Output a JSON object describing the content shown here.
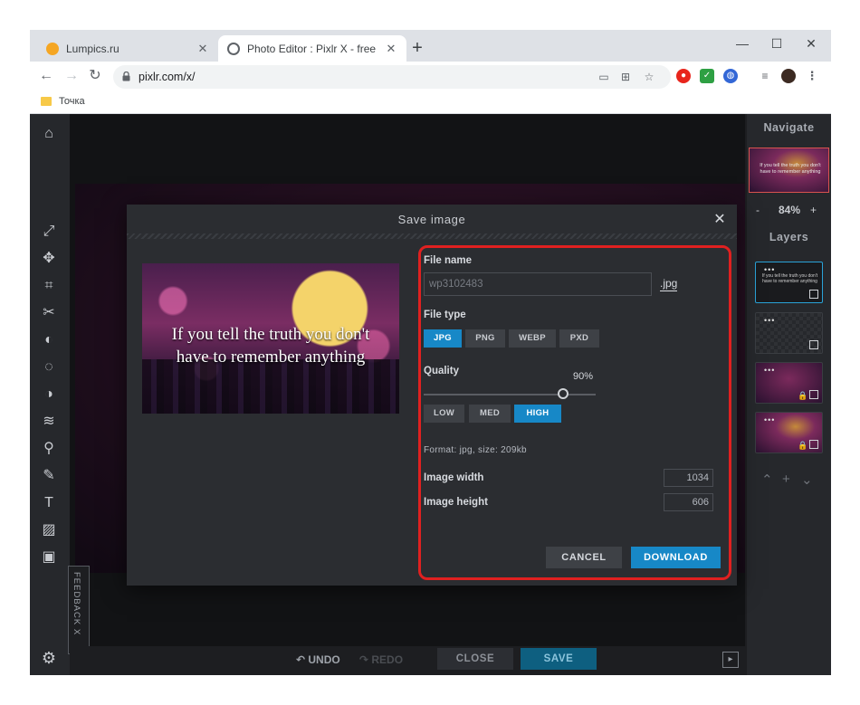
{
  "browser": {
    "tabs": [
      {
        "title": "Lumpics.ru",
        "close": "✕"
      },
      {
        "title": "Photo Editor : Pixlr X - free image",
        "close": "✕"
      }
    ],
    "new_tab": "+",
    "window_controls": {
      "minimize": "—",
      "maximize": "☐",
      "close": "✕"
    },
    "url": "pixlr.com/x/",
    "bookmark": "Точка"
  },
  "right_panel": {
    "navigate_title": "Navigate",
    "zoom_minus": "-",
    "zoom_value": "84%",
    "zoom_plus": "+",
    "layers_title": "Layers",
    "layer_text": "If you tell the truth you don't have to remember anything",
    "layer_dots": "•••"
  },
  "bottom_bar": {
    "undo": "UNDO",
    "redo": "REDO",
    "close": "CLOSE",
    "save": "SAVE"
  },
  "feedback": "FEEDBACK  X",
  "dialog": {
    "title": "Save image",
    "close": "✕",
    "preview_text": "If you tell the truth you don't have to remember anything",
    "file_name_label": "File name",
    "file_name_value": "wp3102483",
    "extension": ".jpg",
    "file_type_label": "File type",
    "file_types": [
      "JPG",
      "PNG",
      "WEBP",
      "PXD"
    ],
    "selected_file_type": "JPG",
    "quality_label": "Quality",
    "quality_value": "90%",
    "quality_percent": 90,
    "quality_presets": [
      "LOW",
      "MED",
      "HIGH"
    ],
    "selected_preset": "HIGH",
    "format_info": "Format: jpg, size: 209kb",
    "width_label": "Image width",
    "width_value": "1034",
    "height_label": "Image height",
    "height_value": "606",
    "cancel": "CANCEL",
    "download": "DOWNLOAD"
  },
  "colors": {
    "accent": "#1788c7",
    "highlight_frame": "#e02020",
    "panel": "#2b2d31"
  }
}
